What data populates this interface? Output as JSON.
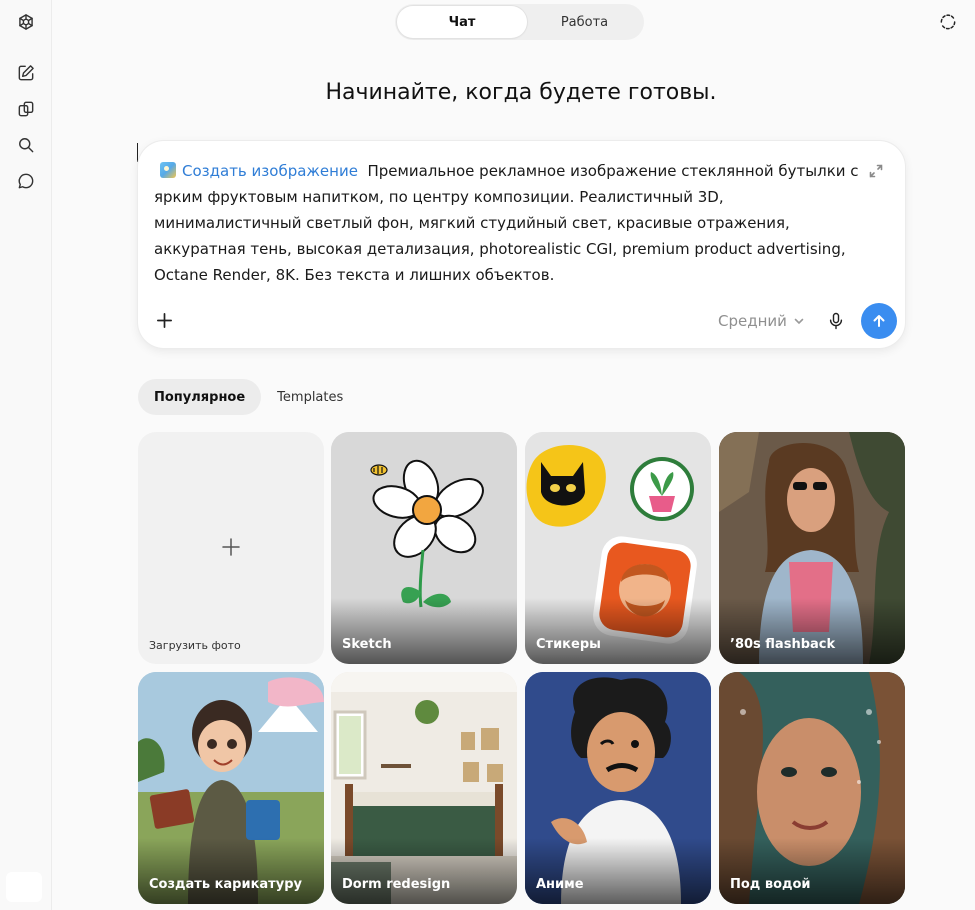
{
  "sidebar": {
    "icons": [
      "openai-logo-icon",
      "new-chat-icon",
      "library-icon",
      "search-icon",
      "chat-bubble-icon"
    ]
  },
  "header": {
    "mode_tabs": [
      {
        "label": "Чат",
        "active": true
      },
      {
        "label": "Работа",
        "active": false
      }
    ],
    "right_icon": "temporary-chat-icon"
  },
  "headline": "Начинайте, когда будете готовы.",
  "composer": {
    "tool_chip_label": "Создать изображение",
    "prompt_text": "Премиальное рекламное изображение стеклянной бутылки с ярким фруктовым напитком, по центру композиции. Реалистичный 3D, минималистичный светлый фон, мягкий студийный свет, красивые отражения, аккуратная тень, высокая детализация, photorealistic CGI, premium product advertising, Octane Render, 8K. Без текста и лишних объектов.",
    "model_label": "Средний",
    "accent_color": "#3a8df0"
  },
  "tabs": [
    {
      "label": "Популярное",
      "active": true
    },
    {
      "label": "Templates",
      "active": false
    }
  ],
  "cards": [
    {
      "label": "Загрузить фото"
    },
    {
      "label": "Sketch"
    },
    {
      "label": "Стикеры"
    },
    {
      "label": "’80s flashback"
    },
    {
      "label": "Создать карикатуру"
    },
    {
      "label": "Dorm redesign"
    },
    {
      "label": "Аниме"
    },
    {
      "label": "Под водой"
    }
  ]
}
